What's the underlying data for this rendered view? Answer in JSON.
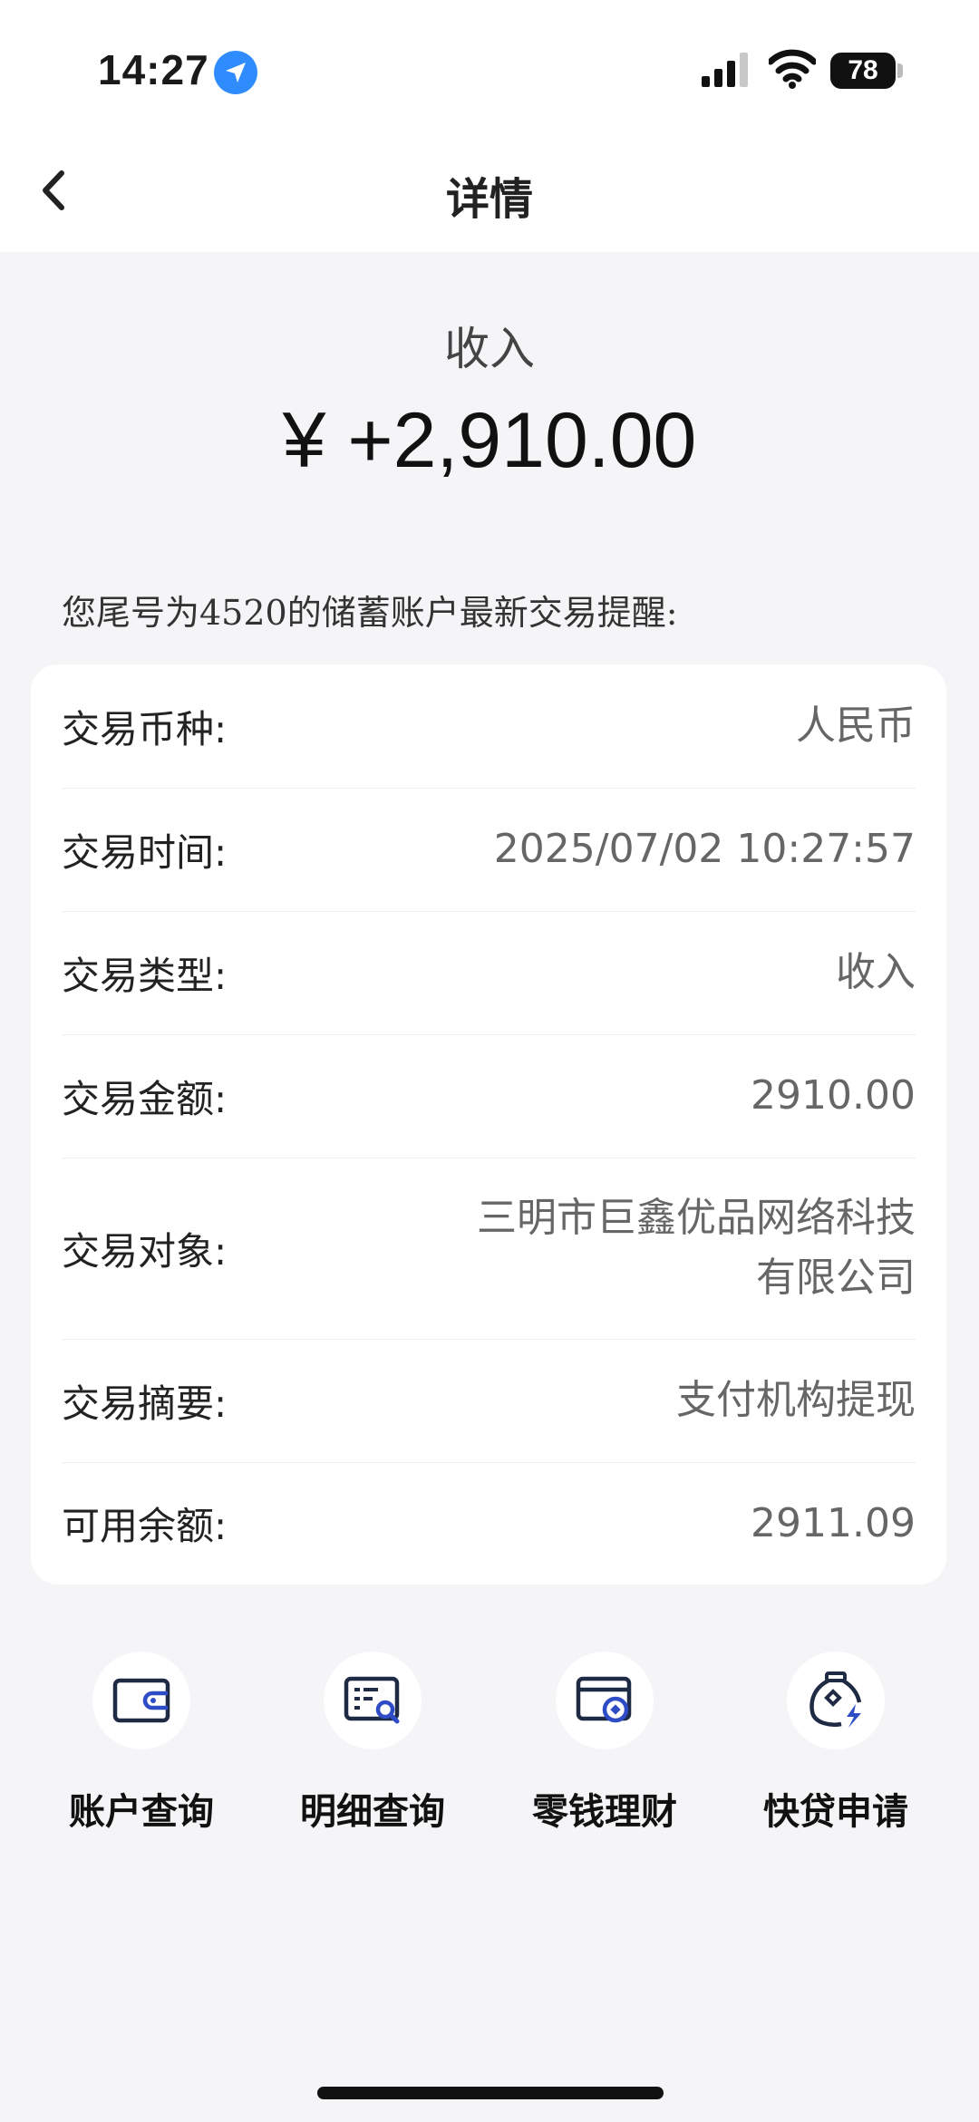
{
  "status_bar": {
    "time": "14:27",
    "battery": "78",
    "icons": [
      "location-arrow-icon",
      "cellular-signal-icon",
      "wifi-icon",
      "battery-icon"
    ]
  },
  "header": {
    "title": "详情",
    "back_icon": "chevron-left-icon"
  },
  "summary": {
    "type": "收入",
    "amount": "¥ +2,910.00"
  },
  "notice": "您尾号为4520的储蓄账户最新交易提醒:",
  "details": [
    {
      "label": "交易币种:",
      "value": "人民币"
    },
    {
      "label": "交易时间:",
      "value": "2025/07/02 10:27:57"
    },
    {
      "label": "交易类型:",
      "value": "收入"
    },
    {
      "label": "交易金额:",
      "value": "2910.00"
    },
    {
      "label": "交易对象:",
      "value_line1": "三明市巨鑫优品网络科技",
      "value_line2": "有限公司"
    },
    {
      "label": "交易摘要:",
      "value": "支付机构提现"
    },
    {
      "label": "可用余额:",
      "value": "2911.09"
    }
  ],
  "actions": [
    {
      "label": "账户查询",
      "icon": "wallet-icon"
    },
    {
      "label": "明细查询",
      "icon": "detail-search-icon"
    },
    {
      "label": "零钱理财",
      "icon": "card-coin-icon"
    },
    {
      "label": "快贷申请",
      "icon": "money-bag-lightning-icon"
    }
  ],
  "colors": {
    "background": "#f5f5f7",
    "card": "#ffffff",
    "icon_navy": "#1f2a44",
    "icon_accent": "#2f4cc7",
    "location_blue": "#2f8cff"
  }
}
